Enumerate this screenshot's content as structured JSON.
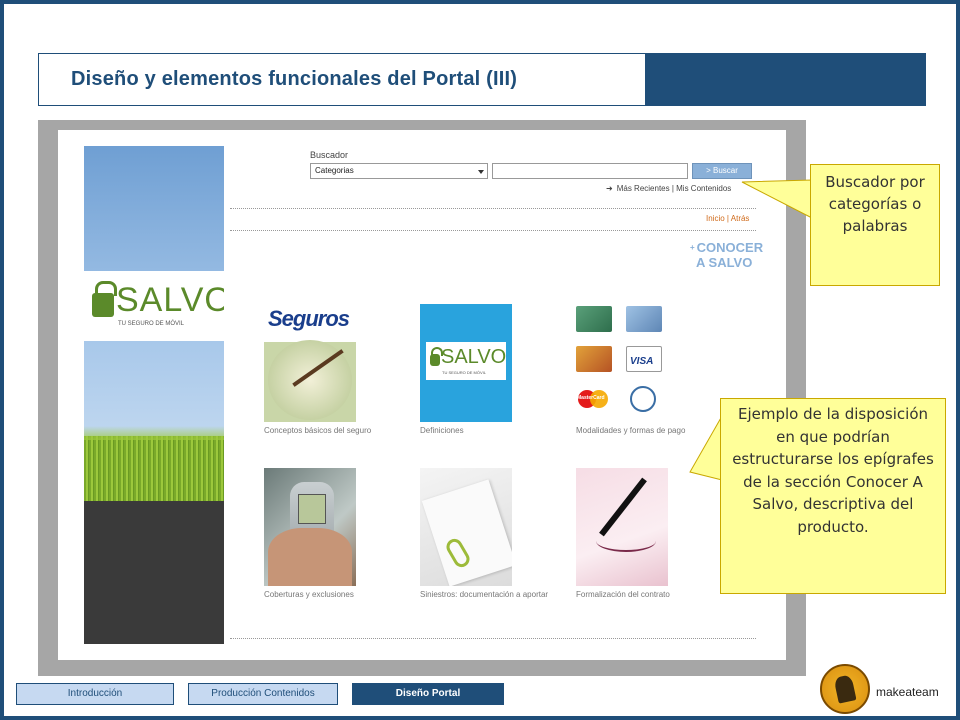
{
  "slide": {
    "title": "Diseño y elementos funcionales del Portal (III)",
    "colors": {
      "primary": "#1f4e79",
      "callout_bg": "#ffff99",
      "accent_link": "#d06a1a",
      "button": "#8ab0d8"
    }
  },
  "portal": {
    "logo": {
      "word": "SALVO",
      "tagline": "TU SEGURO DE MÓVIL"
    },
    "search": {
      "label": "Buscador",
      "category_value": "Categorias",
      "input_value": "",
      "button_label": "> Buscar"
    },
    "recent_links": "Más Recientes | Mis Contenidos",
    "home_links": "Inicio | Atrás",
    "section_heading_line1": "CONOCER",
    "section_heading_line2": "A SALVO",
    "tiles": [
      {
        "caption": "Conceptos básicos del seguro",
        "image_text": "Seguros",
        "icon": "contract-signing-image"
      },
      {
        "caption": "Definiciones",
        "icon": "a-salvo-logo-image"
      },
      {
        "caption": "Modalidades y formas de pago",
        "icon": "payment-cards-image",
        "card_labels": [
          "VISA",
          "MasterCard"
        ]
      },
      {
        "caption": "Coberturas y exclusiones",
        "icon": "mobile-phone-image"
      },
      {
        "caption": "Siniestros: documentación a aportar",
        "icon": "documents-image"
      },
      {
        "caption": "Formalización del contrato",
        "icon": "signature-image"
      }
    ]
  },
  "callouts": {
    "search": "Buscador por categorías o palabras",
    "layout": "Ejemplo de la disposición en que podrían estructurarse los epígrafes de la sección Conocer A Salvo, descriptiva del producto."
  },
  "nav": {
    "tabs": [
      {
        "label": "Introducción",
        "active": false
      },
      {
        "label": "Producción Contenidos",
        "active": false
      },
      {
        "label": "Diseño Portal",
        "active": true
      }
    ]
  },
  "brand": {
    "name": "makeateam"
  }
}
